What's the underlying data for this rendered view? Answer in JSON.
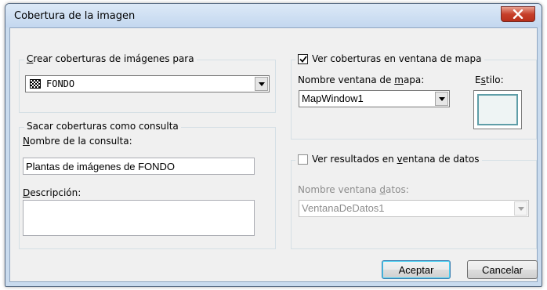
{
  "window": {
    "title": "Cobertura de la imagen"
  },
  "create_group": {
    "legend_prefix": "",
    "legend_ul": "C",
    "legend_rest": "rear coberturas de imágenes para",
    "selected_value": "FONDO"
  },
  "query_group": {
    "legend": "Sacar coberturas como consulta",
    "name_label_ul": "N",
    "name_label_rest": "ombre de la consulta:",
    "name_value": "Plantas de imágenes de FONDO",
    "desc_label_ul": "D",
    "desc_label_rest": "escripción:",
    "desc_value": ""
  },
  "map_group": {
    "checkbox_label": "Ver coberturas en ventana de mapa",
    "checked": true,
    "window_label_prefix": "Nombre ventana de ",
    "window_label_ul": "m",
    "window_label_rest": "apa:",
    "window_value": "MapWindow1",
    "style_label_prefix": "E",
    "style_label_ul": "s",
    "style_label_rest": "tilo:"
  },
  "data_group": {
    "checkbox_label_prefix": "Ver resultados en ",
    "checkbox_label_ul": "v",
    "checkbox_label_rest": "entana de datos",
    "checked": false,
    "window_label_prefix": "Nombre ventana ",
    "window_label_ul": "d",
    "window_label_rest": "atos:",
    "window_value": "VentanaDeDatos1"
  },
  "buttons": {
    "ok": "Aceptar",
    "cancel": "Cancelar"
  },
  "icons": {
    "close": "close-icon",
    "dropdown": "chevron-down-icon",
    "check": "checkmark-icon",
    "layer": "checkered-layer-icon"
  },
  "colors": {
    "close_button": "#c7402b",
    "dialog_bg": "#f0f0f0",
    "frame": "#c9dbee",
    "style_border": "#5f9ea8"
  }
}
